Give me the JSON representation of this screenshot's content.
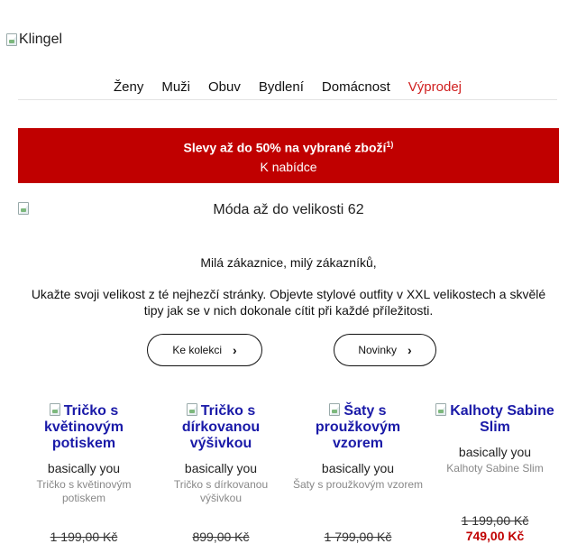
{
  "logo": {
    "alt": "Klingel"
  },
  "nav": [
    "Ženy",
    "Muži",
    "Obuv",
    "Bydlení",
    "Domácnost",
    "Výprodej"
  ],
  "banner": {
    "headline": "Slevy až do 50% na vybrané zboží",
    "footnote": "1)",
    "cta": "K nabídce"
  },
  "hero": {
    "alt": "Móda až do velikosti 62"
  },
  "greeting": "Milá zákaznice, milý zákazníků,",
  "intro": "Ukažte svoji velikost z té nejhezčí stránky. Objevte stylové outfity v XXL velikostech a skvělé tipy jak se v nich dokonale cítit při každé příležitosti.",
  "buttons": [
    {
      "label": "Ke kolekci",
      "chevron": "›"
    },
    {
      "label": "Novinky",
      "chevron": "›"
    }
  ],
  "products": [
    {
      "title": "Tričko s květinovým potiskem",
      "brand": "basically you",
      "sub": "Tričko s květinovým potiskem",
      "old_price": "1 199,00 Kč",
      "new_price": ""
    },
    {
      "title": "Tričko s dírkovanou výšivkou",
      "brand": "basically you",
      "sub": "Tričko s dírkovanou výšivkou",
      "old_price": "899,00 Kč",
      "new_price": ""
    },
    {
      "title": "Šaty s proužkovým vzorem",
      "brand": "basically you",
      "sub": "Šaty s proužkovým vzorem",
      "old_price": "1 799,00 Kč",
      "new_price": ""
    },
    {
      "title": "Kalhoty Sabine Slim",
      "brand": "basically you",
      "sub": "Kalhoty Sabine Slim",
      "old_price": "1 199,00 Kč",
      "new_price": "749,00 Kč"
    }
  ],
  "colors": {
    "accent_red": "#c00000",
    "link_blue": "#1a1aa8"
  }
}
